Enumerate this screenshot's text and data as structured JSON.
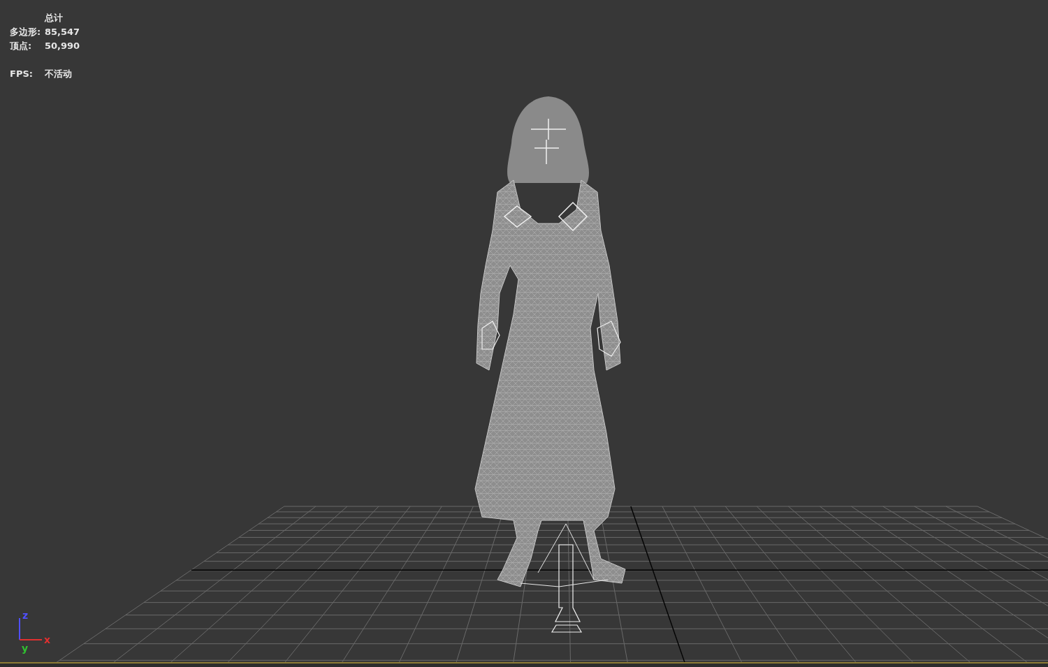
{
  "stats": {
    "title": "总计",
    "rows": [
      {
        "label": "多边形:",
        "value": "85,547"
      },
      {
        "label": "顶点:",
        "value": "50,990"
      }
    ],
    "fps": {
      "label": "FPS:",
      "value": "不活动"
    }
  },
  "axis_gizmo": {
    "axes": [
      {
        "label": "z",
        "color": "#5050ff"
      },
      {
        "label": "y",
        "color": "#30c030"
      },
      {
        "label": "x",
        "color": "#e03030"
      }
    ]
  }
}
